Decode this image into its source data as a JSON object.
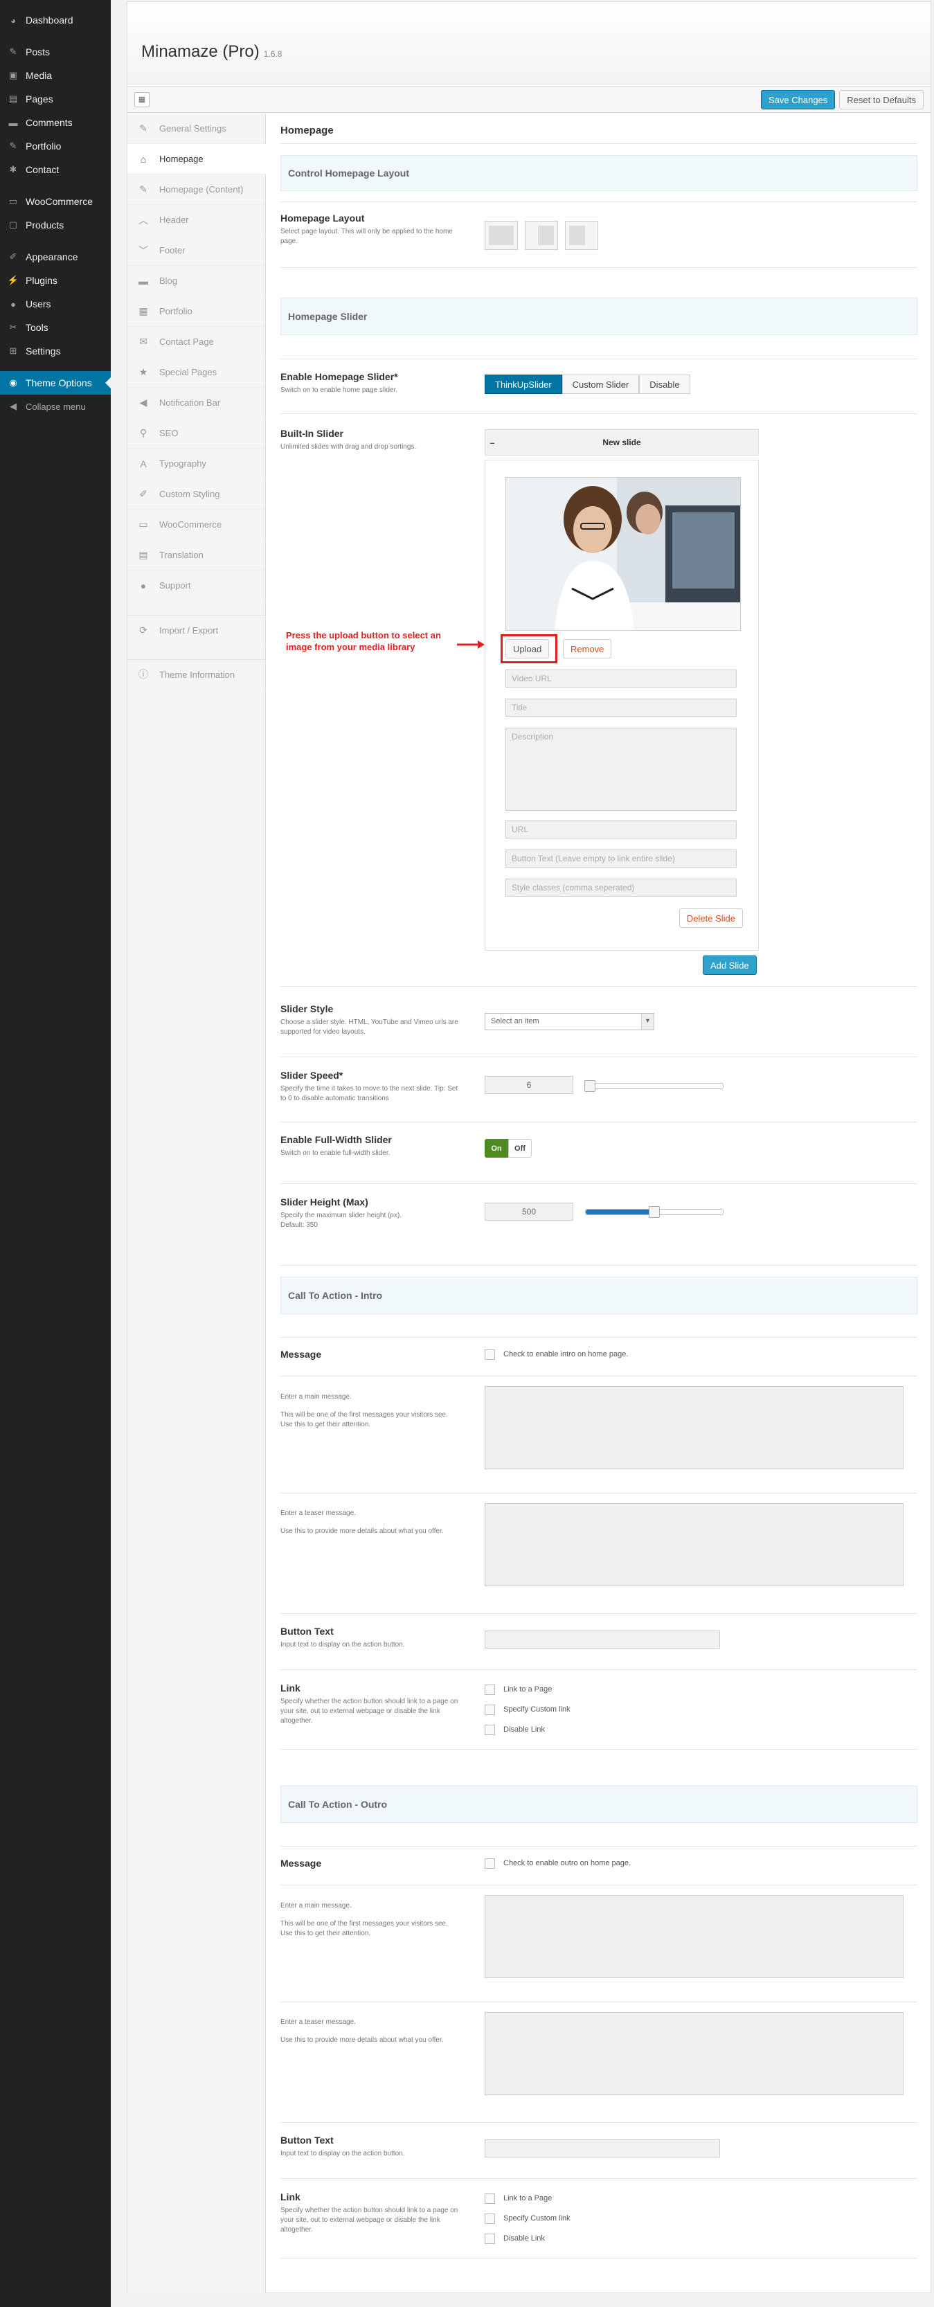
{
  "wp_menu": [
    {
      "label": "Dashboard",
      "icon": "dashboard-icon",
      "glyph": "◕"
    },
    {
      "sep": true
    },
    {
      "label": "Posts",
      "icon": "pin-icon",
      "glyph": "✎"
    },
    {
      "label": "Media",
      "icon": "media-icon",
      "glyph": "▣"
    },
    {
      "label": "Pages",
      "icon": "pages-icon",
      "glyph": "▤"
    },
    {
      "label": "Comments",
      "icon": "comment-icon",
      "glyph": "▬"
    },
    {
      "label": "Portfolio",
      "icon": "pin-icon",
      "glyph": "✎"
    },
    {
      "label": "Contact",
      "icon": "gear-icon",
      "glyph": "✱"
    },
    {
      "sep": true
    },
    {
      "label": "WooCommerce",
      "icon": "woocommerce-icon",
      "glyph": "▭"
    },
    {
      "label": "Products",
      "icon": "products-icon",
      "glyph": "▢"
    },
    {
      "sep": true
    },
    {
      "label": "Appearance",
      "icon": "brush-icon",
      "glyph": "✐"
    },
    {
      "label": "Plugins",
      "icon": "plugin-icon",
      "glyph": "⚡"
    },
    {
      "label": "Users",
      "icon": "user-icon",
      "glyph": "●"
    },
    {
      "label": "Tools",
      "icon": "wrench-icon",
      "glyph": "✂"
    },
    {
      "label": "Settings",
      "icon": "settings-icon",
      "glyph": "⊞"
    },
    {
      "sep": true
    },
    {
      "label": "Theme Options",
      "icon": "theme-options-icon",
      "glyph": "◉",
      "active": true
    },
    {
      "label": "Collapse menu",
      "icon": "collapse-icon",
      "glyph": "◀",
      "collapse": true
    }
  ],
  "header": {
    "title": "Minamaze (Pro)",
    "version": "1.6.8",
    "save": "Save Changes",
    "reset": "Reset to Defaults",
    "toggle_glyph": "▦"
  },
  "nav": [
    {
      "label": "General Settings",
      "icon": "wrench-icon",
      "glyph": "✎"
    },
    {
      "label": "Homepage",
      "icon": "home-icon",
      "glyph": "⌂",
      "active": true
    },
    {
      "label": "Homepage (Content)",
      "icon": "pencil-icon",
      "glyph": "✎"
    },
    {
      "label": "Header",
      "icon": "chevron-up-icon",
      "glyph": "︿"
    },
    {
      "label": "Footer",
      "icon": "chevron-down-icon",
      "glyph": "﹀"
    },
    {
      "label": "Blog",
      "icon": "comment-icon",
      "glyph": "▬"
    },
    {
      "label": "Portfolio",
      "icon": "grid-icon",
      "glyph": "▦"
    },
    {
      "label": "Contact Page",
      "icon": "envelope-icon",
      "glyph": "✉"
    },
    {
      "label": "Special Pages",
      "icon": "star-icon",
      "glyph": "★"
    },
    {
      "label": "Notification Bar",
      "icon": "megaphone-icon",
      "glyph": "◀"
    },
    {
      "label": "SEO",
      "icon": "search-icon",
      "glyph": "⚲"
    },
    {
      "label": "Typography",
      "icon": "font-icon",
      "glyph": "A"
    },
    {
      "label": "Custom Styling",
      "icon": "brush-icon",
      "glyph": "✐"
    },
    {
      "label": "WooCommerce",
      "icon": "cart-icon",
      "glyph": "▭"
    },
    {
      "label": "Translation",
      "icon": "translate-icon",
      "glyph": "▤"
    },
    {
      "label": "Support",
      "icon": "user-icon",
      "glyph": "●"
    },
    {
      "label": "Import / Export",
      "icon": "refresh-icon",
      "glyph": "⟳",
      "gap": true
    },
    {
      "label": "Theme Information",
      "icon": "info-icon",
      "glyph": "ⓘ",
      "gap": true
    }
  ],
  "main": {
    "title": "Homepage",
    "sec_layout": "Control Homepage Layout",
    "layout_label": "Homepage Layout",
    "layout_desc": "Select page layout. This will only be applied to the home page.",
    "sec_slider": "Homepage Slider",
    "enable_label": "Enable Homepage Slider*",
    "enable_desc": "Switch on to enable home page slider.",
    "enable_opts": [
      "ThinkUpSlider",
      "Custom Slider",
      "Disable"
    ],
    "builtin_label": "Built-In Slider",
    "builtin_desc": "Unlimited slides with drag and drop sortings.",
    "slide_collapse": "–",
    "slide_title": "New slide",
    "upload": "Upload",
    "remove": "Remove",
    "note": "Press the upload button to select an image from your media library",
    "fields": [
      "Video URL",
      "Title",
      "Description",
      "URL",
      "Button Text (Leave empty to link entire slide)",
      "Style classes (comma seperated)"
    ],
    "delete": "Delete Slide",
    "add": "Add Slide",
    "style_label": "Slider Style",
    "style_desc": "Choose a slider style. HTML, YouTube and Vimeo urls are supported for video layouts.",
    "style_select": "Select an item",
    "speed_label": "Slider Speed*",
    "speed_desc": "Specify the time it takes to move to the next slide. Tip: Set to 0 to disable automatic transitions",
    "speed_value": "6",
    "fullwidth_label": "Enable Full-Width Slider",
    "fullwidth_desc": "Switch on to enable full-width slider.",
    "on": "On",
    "off": "Off",
    "height_label": "Slider Height (Max)",
    "height_desc": "Specify the maximum slider height (px).",
    "height_default": "Default: 350",
    "height_value": "500",
    "height_fraction": 0.5,
    "cta": [
      {
        "section": "Call To Action - Intro",
        "message": "Message",
        "message_chk": "Check to enable intro on home page.",
        "main_title": "Enter a main message.",
        "main_desc": "This will be one of the first messages your visitors see. Use this to get their attention.",
        "teaser_title": "Enter a teaser message.",
        "teaser_desc": "Use this to provide more details about what you offer.",
        "btn_label": "Button Text",
        "btn_desc": "Input text to display on the action button.",
        "link_label": "Link",
        "link_desc": "Specify whether the action button should link to a page on your site, out to external webpage or disable the link altogether.",
        "links": [
          "Link to a Page",
          "Specify Custom link",
          "Disable Link"
        ]
      },
      {
        "section": "Call To Action - Outro",
        "message": "Message",
        "message_chk": "Check to enable outro on home page.",
        "main_title": "Enter a main message.",
        "main_desc": "This will be one of the first messages your visitors see. Use this to get their attention.",
        "teaser_title": "Enter a teaser message.",
        "teaser_desc": "Use this to provide more details about what you offer.",
        "btn_label": "Button Text",
        "btn_desc": "Input text to display on the action button.",
        "link_label": "Link",
        "link_desc": "Specify whether the action button should link to a page on your site, out to external webpage or disable the link altogether.",
        "links": [
          "Link to a Page",
          "Specify Custom link",
          "Disable Link"
        ]
      }
    ]
  }
}
